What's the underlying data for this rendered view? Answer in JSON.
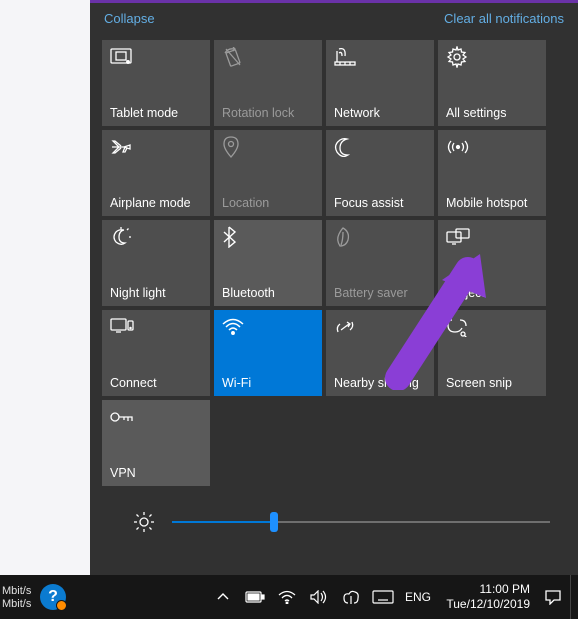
{
  "header": {
    "collapse": "Collapse",
    "clear": "Clear all notifications"
  },
  "tiles": [
    {
      "label": "Tablet mode",
      "icon": "tablet",
      "state": "dim"
    },
    {
      "label": "Rotation lock",
      "icon": "rotation",
      "state": "disabled"
    },
    {
      "label": "Network",
      "icon": "network",
      "state": "dim"
    },
    {
      "label": "All settings",
      "icon": "settings",
      "state": "dim"
    },
    {
      "label": "Airplane mode",
      "icon": "airplane",
      "state": "dim"
    },
    {
      "label": "Location",
      "icon": "location",
      "state": "disabled"
    },
    {
      "label": "Focus assist",
      "icon": "moon",
      "state": "dim"
    },
    {
      "label": "Mobile hotspot",
      "icon": "hotspot",
      "state": "dim"
    },
    {
      "label": "Night light",
      "icon": "nightlight",
      "state": "dim"
    },
    {
      "label": "Bluetooth",
      "icon": "bluetooth",
      "state": "normal"
    },
    {
      "label": "Battery saver",
      "icon": "leaf",
      "state": "disabled"
    },
    {
      "label": "Project",
      "icon": "project",
      "state": "dim"
    },
    {
      "label": "Connect",
      "icon": "connect",
      "state": "dim"
    },
    {
      "label": "Wi-Fi",
      "icon": "wifi",
      "state": "active"
    },
    {
      "label": "Nearby sharing",
      "icon": "nearby",
      "state": "dim"
    },
    {
      "label": "Screen snip",
      "icon": "snip",
      "state": "dim"
    },
    {
      "label": "VPN",
      "icon": "vpn",
      "state": "normal"
    }
  ],
  "brightness": {
    "percent": 27
  },
  "taskbar": {
    "net_label_top": "Mbit/s",
    "net_label_bottom": "Mbit/s",
    "language": "ENG",
    "time": "11:00 PM",
    "date": "Tue/12/10/2019"
  },
  "colors": {
    "accent": "#0078d7",
    "link": "#63aee4",
    "arrow": "#8a3ed6"
  }
}
